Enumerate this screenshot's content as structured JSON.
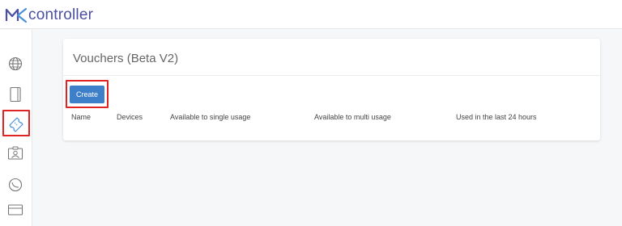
{
  "app": {
    "logo_text": "controller",
    "brand_color": "#4a4fa3"
  },
  "sidebar": {
    "items": [
      {
        "icon": "globe-icon",
        "name": "sidebar-item-globe"
      },
      {
        "icon": "document-icon",
        "name": "sidebar-item-document"
      },
      {
        "icon": "ticket-icon",
        "name": "sidebar-item-vouchers",
        "active": true
      },
      {
        "icon": "id-card-icon",
        "name": "sidebar-item-profile"
      },
      {
        "icon": "dial-icon",
        "name": "sidebar-item-dial"
      },
      {
        "icon": "credit-card-icon",
        "name": "sidebar-item-billing"
      }
    ]
  },
  "main": {
    "title": "Vouchers (Beta V2)",
    "create_label": "Create",
    "columns": [
      "Name",
      "Devices",
      "Available to single usage",
      "Available to multi usage",
      "Used in the last 24 hours"
    ]
  },
  "colors": {
    "primary_button": "#3d7fc8",
    "highlight": "#e02424",
    "active_icon": "#4a90d9"
  }
}
